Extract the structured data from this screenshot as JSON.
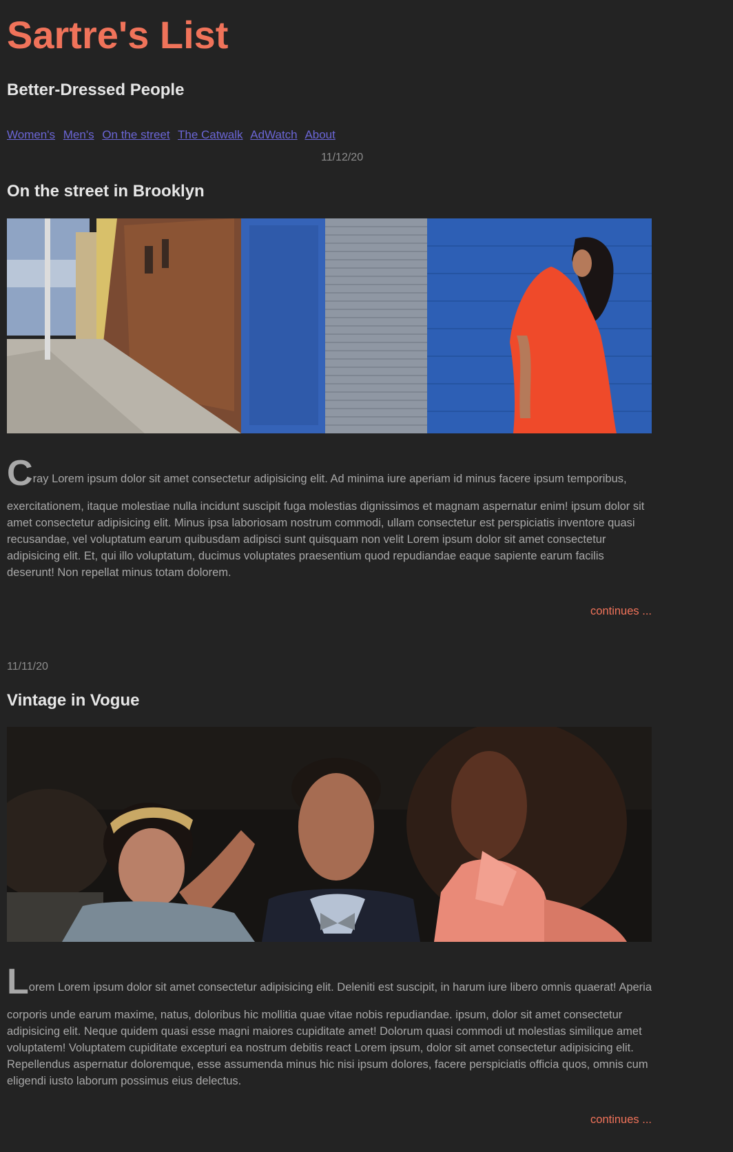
{
  "site": {
    "title": "Sartre's List",
    "subtitle": "Better-Dressed People"
  },
  "nav": {
    "items": [
      {
        "label": "Women's"
      },
      {
        "label": "Men's"
      },
      {
        "label": "On the street"
      },
      {
        "label": "The Catwalk"
      },
      {
        "label": "AdWatch"
      },
      {
        "label": "About"
      }
    ]
  },
  "posts": [
    {
      "date": "11/12/20",
      "title": "On the street in Brooklyn",
      "image_desc": "woman in orange dress leaning against blue brick wall on Brooklyn sidewalk",
      "dropcap": "C",
      "first_line": "ray Lorem ipsum dolor sit amet consectetur adipisicing elit. Ad minima iure aperiam id minus facere ipsum temporibus,",
      "body": "exercitationem, itaque molestiae nulla incidunt suscipit fuga molestias dignissimos et magnam aspernatur enim! ipsum dolor sit amet consectetur adipisicing elit. Minus ipsa laboriosam nostrum commodi, ullam consectetur est perspiciatis inventore quasi recusandae, vel voluptatum earum quibusdam adipisci sunt quisquam non velit Lorem ipsum dolor sit amet consectetur adipisicing elit. Et, qui illo voluptatum, ducimus voluptates praesentium quod repudiandae eaque sapiente earum facilis deserunt! Non repellat minus totam dolorem.",
      "continues": "continues ..."
    },
    {
      "date": "11/11/20",
      "title": "Vintage in Vogue",
      "image_desc": "three fashionably dressed people at night event",
      "dropcap": "L",
      "first_line": "orem Lorem ipsum dolor sit amet consectetur adipisicing elit. Deleniti est suscipit, in harum iure libero omnis quaerat! Aperiam",
      "body": "corporis unde earum maxime, natus, doloribus hic mollitia quae vitae nobis repudiandae. ipsum, dolor sit amet consectetur adipisicing elit. Neque quidem quasi esse magni maiores cupiditate amet! Dolorum quasi commodi ut molestias similique amet voluptatem! Voluptatem cupiditate excepturi ea nostrum debitis react Lorem ipsum, dolor sit amet consectetur adipisicing elit. Repellendus aspernatur doloremque, esse assumenda minus hic nisi ipsum dolores, facere perspiciatis officia quos, omnis cum eligendi iusto laborum possimus eius delectus.",
      "continues": "continues ..."
    }
  ],
  "colors": {
    "background": "#232323",
    "accent": "#f0735a",
    "link": "#6b66d6",
    "heading": "#e6e6e6",
    "text": "#a8a8a8"
  }
}
